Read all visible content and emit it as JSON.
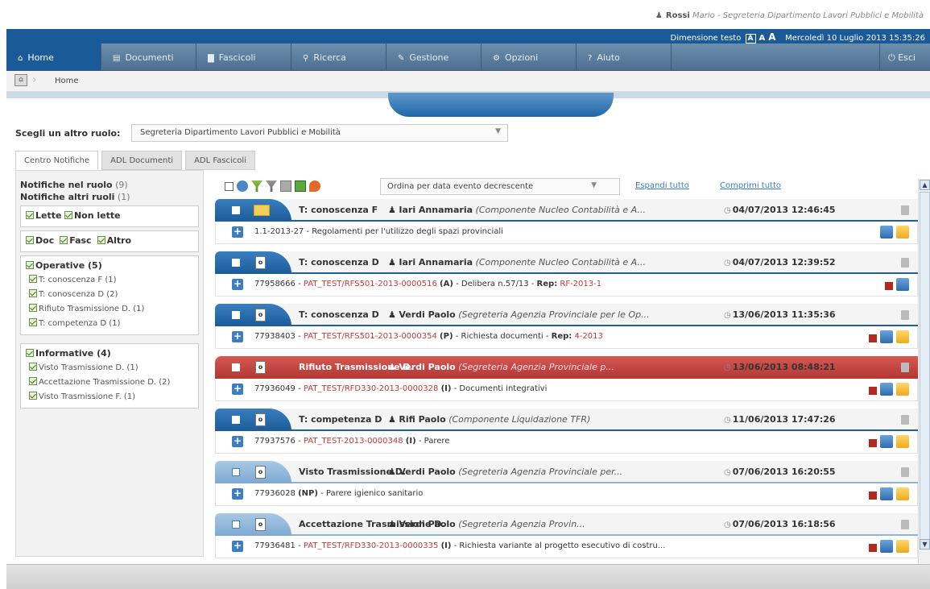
{
  "user": {
    "name": "Rossi",
    "first_name": "Mario",
    "office": "Segreteria Dipartimento Lavori Pubblici e Mobilità"
  },
  "topbar": {
    "text_size_label": "Dimensione testo",
    "sizes": [
      "A",
      "A",
      "A"
    ],
    "datetime": "Mercoledì 10 Luglio 2013 15:35:26"
  },
  "nav": {
    "tabs": [
      {
        "label": "Home",
        "icon": "home-icon",
        "glyph": "⌂"
      },
      {
        "label": "Documenti",
        "icon": "document-icon",
        "glyph": "▤"
      },
      {
        "label": "Fascicoli",
        "icon": "folder-icon",
        "glyph": "▇"
      },
      {
        "label": "Ricerca",
        "icon": "search-icon",
        "glyph": "⚲"
      },
      {
        "label": "Gestione",
        "icon": "pencil-icon",
        "glyph": "✎"
      },
      {
        "label": "Opzioni",
        "icon": "options-icon",
        "glyph": "⚙"
      },
      {
        "label": "Aiuto",
        "icon": "help-icon",
        "glyph": "?"
      }
    ],
    "exit_label": "Esci",
    "exit_glyph": "⏻"
  },
  "breadcrumb": {
    "current": "Home"
  },
  "role": {
    "label": "Scegli un altro ruolo:",
    "selected": "Segreteria Dipartimento Lavori Pubblici e Mobilità"
  },
  "left_tabs": [
    "Centro Notifiche",
    "ADL Documenti",
    "ADL Fascicoli"
  ],
  "sidebar": {
    "notifiche_ruolo": "Notifiche nel ruolo",
    "notifiche_ruolo_count": "(9)",
    "notifiche_altri": "Notifiche altri ruoli",
    "notifiche_altri_count": "(1)",
    "read_filters": [
      "Lette",
      "Non lette"
    ],
    "type_filters": [
      "Doc",
      "Fasc",
      "Altro"
    ],
    "operative": {
      "label": "Operative (5)",
      "items": [
        "T: conoscenza F (1)",
        "T: conoscenza D (2)",
        "Rifiuto Trasmissione D. (1)",
        "T: competenza D (1)"
      ]
    },
    "informative": {
      "label": "Informative (4)",
      "items": [
        "Visto Trasmissione D. (1)",
        "Accettazione Trasmissione D. (2)",
        "Visto Trasmissione F. (1)"
      ]
    }
  },
  "toolbar": {
    "order_selected": "Ordina per data evento decrescente",
    "expand_all": "Espandi tutto",
    "collapse_all": "Comprimi tutto"
  },
  "notifications": [
    {
      "style": "blue",
      "kind": "folder",
      "title": "T: conoscenza F",
      "person": "Iari Annamaria",
      "role": "(Componente Nucleo Contabilità e A...",
      "date": "04/07/2013 12:46:45",
      "id": "1.1-2013-27",
      "segnatura": "",
      "tipo": "",
      "desc": "Regolamenti per l'utilizzo degli spazi provinciali",
      "rep": ""
    },
    {
      "style": "blue",
      "kind": "doc",
      "title": "T: conoscenza D",
      "person": "Iari Annamaria",
      "role": "(Componente Nucleo Contabilità e A...",
      "date": "04/07/2013 12:39:52",
      "id": "77958666",
      "segnatura": "PAT_TEST/RFS501-2013-0000516",
      "tipo": "(A)",
      "desc": "Delibera n.57/13",
      "rep": "RF-2013-1"
    },
    {
      "style": "blue",
      "kind": "doc",
      "title": "T: conoscenza D",
      "person": "Verdi Paolo",
      "role": "(Segreteria Agenzia Provinciale per le Op...",
      "date": "13/06/2013 11:35:36",
      "id": "77938403",
      "segnatura": "PAT_TEST/RFS501-2013-0000354",
      "tipo": "(P)",
      "desc": "Richiesta documenti",
      "rep": "4-2013"
    },
    {
      "style": "red",
      "kind": "doc",
      "title": "Rifiuto Trasmissione D.",
      "person": "Verdi Paolo",
      "role": "(Segreteria Agenzia Provinciale p...",
      "date": "13/06/2013 08:48:21",
      "id": "77936049",
      "segnatura": "PAT_TEST/RFD330-2013-0000328",
      "tipo": "(I)",
      "desc": "Documenti integrativi",
      "rep": ""
    },
    {
      "style": "blue",
      "kind": "doc",
      "title": "T: competenza D",
      "person": "Rifi Paolo",
      "role": "(Componente Liquidazione TFR)",
      "date": "11/06/2013 17:47:26",
      "id": "77937576",
      "segnatura": "PAT_TEST-2013-0000348",
      "tipo": "(I)",
      "desc": "Parere",
      "rep": ""
    },
    {
      "style": "light",
      "kind": "doc",
      "title": "Visto Trasmissione D.",
      "person": "Verdi Paolo",
      "role": "(Segreteria Agenzia Provinciale per...",
      "date": "07/06/2013 16:20:55",
      "id": "77936028",
      "segnatura": "",
      "tipo": "(NP)",
      "desc": "Parere igienico sanitario",
      "rep": ""
    },
    {
      "style": "light",
      "kind": "doc",
      "title": "Accettazione Trasmissione D.",
      "person": "Verdi Paolo",
      "role": "(Segreteria Agenzia Provin...",
      "date": "07/06/2013 16:18:56",
      "id": "77936481",
      "segnatura": "PAT_TEST/RFD330-2013-0000335",
      "tipo": "(I)",
      "desc": "Richiesta variante al progetto esecutivo di costru...",
      "rep": ""
    }
  ],
  "labels": {
    "rep_prefix": "Rep:",
    "doc_glyph": "o"
  }
}
